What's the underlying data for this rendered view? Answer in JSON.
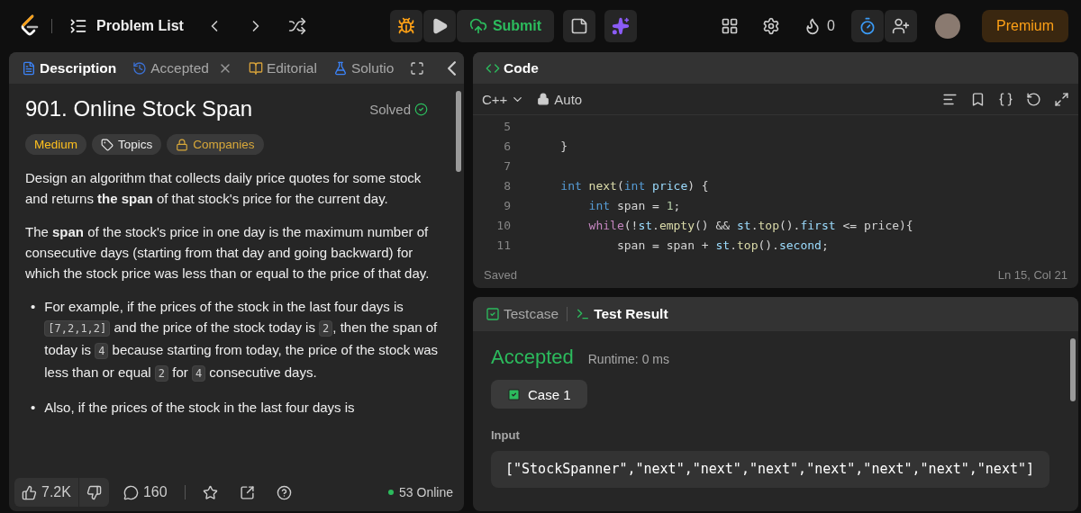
{
  "topbar": {
    "title": "Problem List",
    "streak": "0",
    "premium": "Premium",
    "submit": "Submit"
  },
  "left_tabs": [
    {
      "label": "Description",
      "selected": true,
      "closable": false
    },
    {
      "label": "Accepted",
      "selected": false,
      "closable": true
    },
    {
      "label": "Editorial",
      "selected": false,
      "closable": false
    },
    {
      "label": "Solutio",
      "selected": false,
      "closable": false
    }
  ],
  "problem": {
    "title": "901. Online Stock Span",
    "status": "Solved",
    "solved": true,
    "tags": [
      {
        "label": "Medium",
        "kind": "difficulty"
      },
      {
        "label": "Topics",
        "kind": "topics"
      },
      {
        "label": "Companies",
        "kind": "companies"
      }
    ],
    "paragraphs": [
      "Design an algorithm that collects daily price quotes for some stock and returns **the span** of that stock's price for the current day.",
      "The **span** of the stock's price in one day is the maximum number of consecutive days (starting from that day and going backward) for which the stock price was less than or equal to the price of that day."
    ],
    "bullets": [
      {
        "marker": "•",
        "parts": [
          {
            "kind": "text",
            "text": "For example, if the prices of the stock in the last four days is "
          },
          {
            "kind": "code",
            "text": "[7,2,1,2]"
          },
          {
            "kind": "text",
            "text": " and the price of the stock today is "
          },
          {
            "kind": "code",
            "text": "2"
          },
          {
            "kind": "text",
            "text": ", then the span of today is "
          },
          {
            "kind": "code",
            "text": "4"
          },
          {
            "kind": "text",
            "text": " because starting from today, the price of the stock was less than or equal "
          },
          {
            "kind": "code",
            "text": "2"
          },
          {
            "kind": "text",
            "text": " for "
          },
          {
            "kind": "code",
            "text": "4"
          },
          {
            "kind": "text",
            "text": " consecutive days."
          }
        ]
      },
      {
        "marker": "•",
        "parts": [
          {
            "kind": "text",
            "text": "Also, if the prices of the stock in the last four days is"
          }
        ]
      }
    ]
  },
  "footer": {
    "likes": "7.2K",
    "comments": "160",
    "online": "53 Online"
  },
  "code": {
    "tab": "Code",
    "language": "C++",
    "mode": "Auto",
    "saved": "Saved",
    "position": "Ln 15, Col 21",
    "lines": [
      {
        "number": "5"
      },
      {
        "number": "6",
        "tokens": [
          {
            "kind": "plain",
            "text": "    }"
          }
        ]
      },
      {
        "number": "7"
      },
      {
        "number": "8",
        "tokens": [
          {
            "kind": "type",
            "text": "    int"
          },
          {
            "kind": "func",
            "text": " next"
          },
          {
            "kind": "plain",
            "text": "("
          },
          {
            "kind": "type",
            "text": "int"
          },
          {
            "kind": "var",
            "text": " price"
          },
          {
            "kind": "plain",
            "text": ") {"
          }
        ]
      },
      {
        "number": "9",
        "tokens": [
          {
            "kind": "type",
            "text": "        int"
          },
          {
            "kind": "plain",
            "text": " span = "
          },
          {
            "kind": "num",
            "text": "1"
          },
          {
            "kind": "plain",
            "text": ";"
          }
        ]
      },
      {
        "number": "10",
        "tokens": [
          {
            "kind": "control",
            "text": "        while"
          },
          {
            "kind": "plain",
            "text": "(!"
          },
          {
            "kind": "var",
            "text": "st"
          },
          {
            "kind": "plain",
            "text": "."
          },
          {
            "kind": "func",
            "text": "empty"
          },
          {
            "kind": "plain",
            "text": "() && "
          },
          {
            "kind": "var",
            "text": "st"
          },
          {
            "kind": "plain",
            "text": "."
          },
          {
            "kind": "func",
            "text": "top"
          },
          {
            "kind": "plain",
            "text": "()."
          },
          {
            "kind": "var",
            "text": "first"
          },
          {
            "kind": "plain",
            "text": " <= price){"
          }
        ]
      },
      {
        "number": "11",
        "tokens": [
          {
            "kind": "plain",
            "text": "            span = span + "
          },
          {
            "kind": "var",
            "text": "st"
          },
          {
            "kind": "plain",
            "text": "."
          },
          {
            "kind": "func",
            "text": "top"
          },
          {
            "kind": "plain",
            "text": "()."
          },
          {
            "kind": "var",
            "text": "second"
          },
          {
            "kind": "plain",
            "text": ";"
          }
        ]
      }
    ]
  },
  "result_tabs": [
    {
      "label": "Testcase",
      "selected": false
    },
    {
      "label": "Test Result",
      "selected": true
    }
  ],
  "result": {
    "verdict": "Accepted",
    "runtime": "Runtime: 0 ms",
    "cases": [
      {
        "label": "Case 1",
        "selected": true,
        "passed": true
      }
    ],
    "input_label": "Input",
    "input_value": "[\"StockSpanner\",\"next\",\"next\",\"next\",\"next\",\"next\",\"next\",\"next\"]"
  }
}
